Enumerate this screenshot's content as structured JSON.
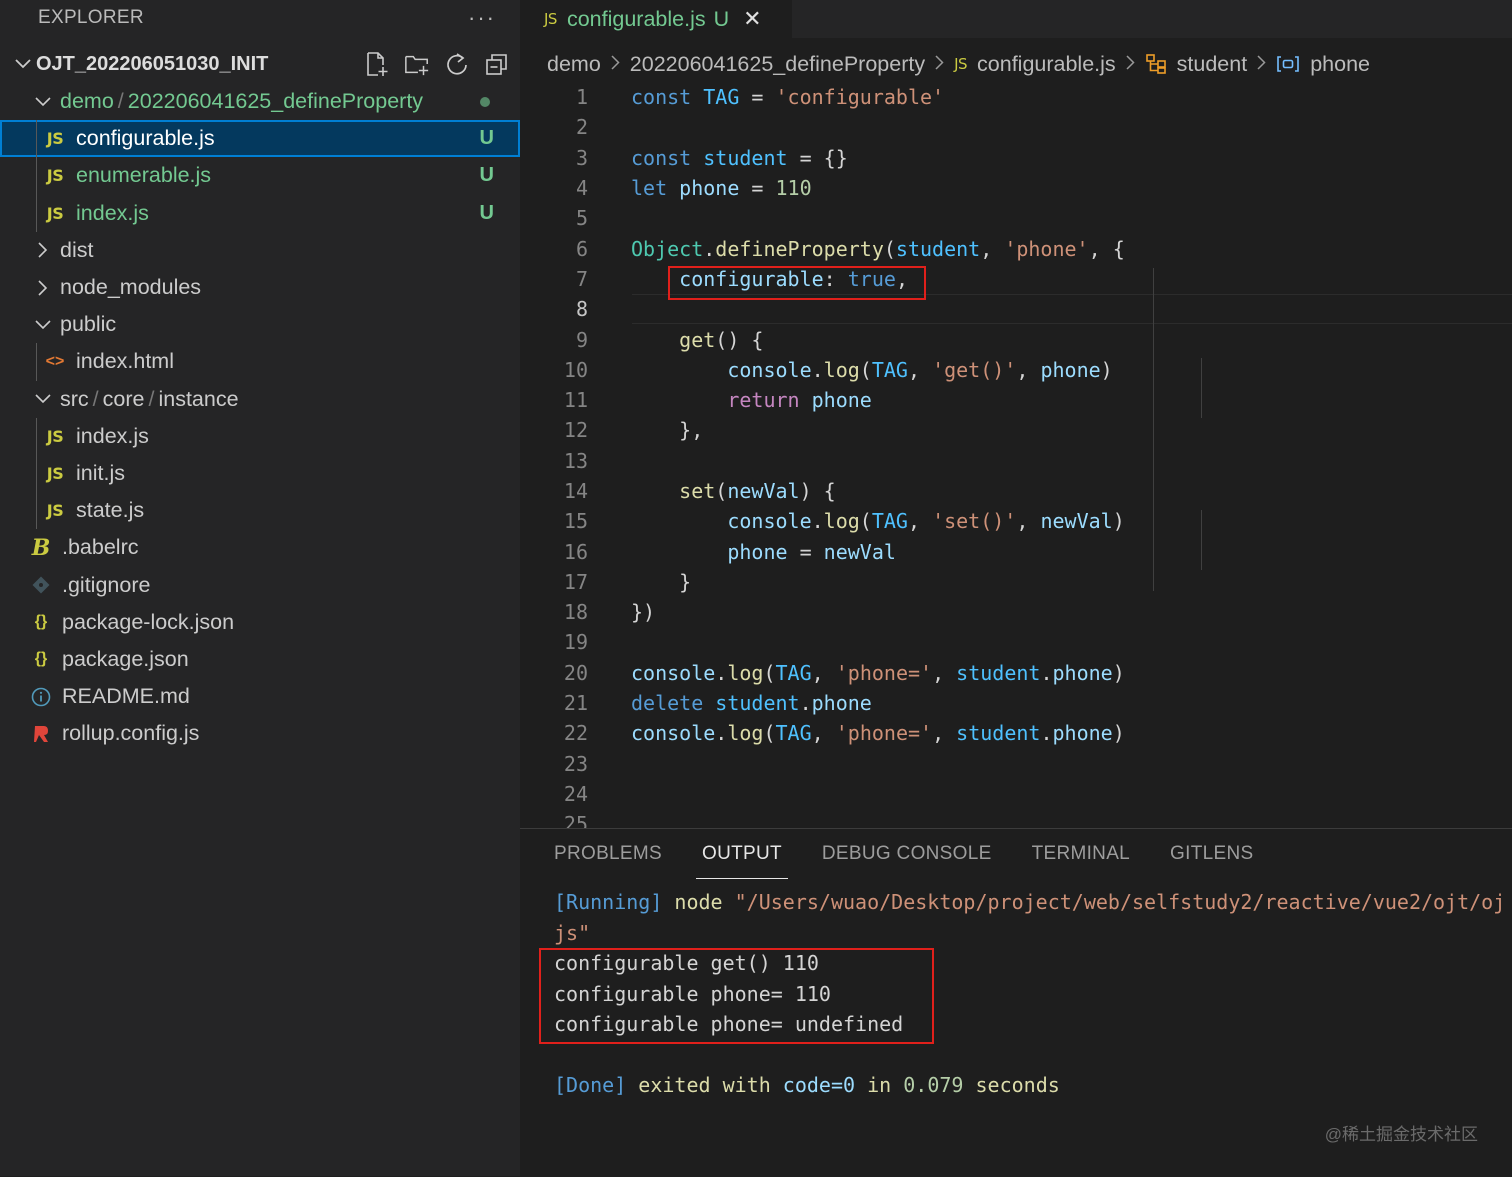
{
  "explorer": {
    "title": "EXPLORER",
    "more": "···",
    "project": "OJT_202206051030_INIT",
    "actions": [
      "new-file-icon",
      "new-folder-icon",
      "refresh-icon",
      "collapse-icon"
    ],
    "items": [
      {
        "kind": "folder",
        "open": true,
        "level": 1,
        "parts": [
          "demo",
          "202206041625_defineProperty"
        ],
        "color": "green",
        "dot": true
      },
      {
        "kind": "js",
        "level": 2,
        "label": "configurable.js",
        "badge": "U",
        "selected": true
      },
      {
        "kind": "js",
        "level": 2,
        "label": "enumerable.js",
        "badge": "U"
      },
      {
        "kind": "js",
        "level": 2,
        "label": "index.js",
        "badge": "U"
      },
      {
        "kind": "folder",
        "open": false,
        "level": 1,
        "parts": [
          "dist"
        ]
      },
      {
        "kind": "folder",
        "open": false,
        "level": 1,
        "parts": [
          "node_modules"
        ]
      },
      {
        "kind": "folder",
        "open": true,
        "level": 1,
        "parts": [
          "public"
        ]
      },
      {
        "kind": "html",
        "level": 2,
        "label": "index.html"
      },
      {
        "kind": "folder",
        "open": true,
        "level": 1,
        "parts": [
          "src",
          "core",
          "instance"
        ]
      },
      {
        "kind": "js",
        "level": 2,
        "label": "index.js"
      },
      {
        "kind": "js",
        "level": 2,
        "label": "init.js"
      },
      {
        "kind": "js",
        "level": 2,
        "label": "state.js"
      },
      {
        "kind": "babel",
        "level": 1,
        "label": ".babelrc"
      },
      {
        "kind": "git",
        "level": 1,
        "label": ".gitignore"
      },
      {
        "kind": "json",
        "level": 1,
        "label": "package-lock.json"
      },
      {
        "kind": "json",
        "level": 1,
        "label": "package.json"
      },
      {
        "kind": "info",
        "level": 1,
        "label": "README.md"
      },
      {
        "kind": "rollup",
        "level": 1,
        "label": "rollup.config.js"
      }
    ]
  },
  "tab": {
    "icon": "JS",
    "label": "configurable.js",
    "status": "U",
    "close": "✕"
  },
  "breadcrumb": [
    "demo",
    "202206041625_defineProperty",
    "configurable.js",
    "student",
    "phone"
  ],
  "code": {
    "active_line": 8,
    "lines": [
      [
        [
          "kw",
          "const"
        ],
        [
          "pun",
          " "
        ],
        [
          "cst",
          "TAG"
        ],
        [
          "pun",
          " = "
        ],
        [
          "str",
          "'configurable'"
        ]
      ],
      [],
      [
        [
          "kw",
          "const"
        ],
        [
          "pun",
          " "
        ],
        [
          "cst",
          "student"
        ],
        [
          "pun",
          " = {}"
        ]
      ],
      [
        [
          "kw",
          "let"
        ],
        [
          "pun",
          " "
        ],
        [
          "var",
          "phone"
        ],
        [
          "pun",
          " = "
        ],
        [
          "num",
          "110"
        ]
      ],
      [],
      [
        [
          "cls",
          "Object"
        ],
        [
          "pun",
          "."
        ],
        [
          "fn",
          "defineProperty"
        ],
        [
          "pun",
          "("
        ],
        [
          "cst",
          "student"
        ],
        [
          "pun",
          ", "
        ],
        [
          "str",
          "'phone'"
        ],
        [
          "pun",
          ", {"
        ]
      ],
      [
        [
          "pun",
          "    "
        ],
        [
          "var",
          "configurable"
        ],
        [
          "pun",
          ": "
        ],
        [
          "kw",
          "true"
        ],
        [
          "pun",
          ","
        ]
      ],
      [],
      [
        [
          "pun",
          "    "
        ],
        [
          "fn",
          "get"
        ],
        [
          "pun",
          "() {"
        ]
      ],
      [
        [
          "pun",
          "        "
        ],
        [
          "var",
          "console"
        ],
        [
          "pun",
          "."
        ],
        [
          "fn",
          "log"
        ],
        [
          "pun",
          "("
        ],
        [
          "cst",
          "TAG"
        ],
        [
          "pun",
          ", "
        ],
        [
          "str",
          "'get()'"
        ],
        [
          "pun",
          ", "
        ],
        [
          "var",
          "phone"
        ],
        [
          "pun",
          ")"
        ]
      ],
      [
        [
          "pun",
          "        "
        ],
        [
          "ctl",
          "return"
        ],
        [
          "pun",
          " "
        ],
        [
          "var",
          "phone"
        ]
      ],
      [
        [
          "pun",
          "    },"
        ]
      ],
      [],
      [
        [
          "pun",
          "    "
        ],
        [
          "fn",
          "set"
        ],
        [
          "pun",
          "("
        ],
        [
          "var",
          "newVal"
        ],
        [
          "pun",
          ") {"
        ]
      ],
      [
        [
          "pun",
          "        "
        ],
        [
          "var",
          "console"
        ],
        [
          "pun",
          "."
        ],
        [
          "fn",
          "log"
        ],
        [
          "pun",
          "("
        ],
        [
          "cst",
          "TAG"
        ],
        [
          "pun",
          ", "
        ],
        [
          "str",
          "'set()'"
        ],
        [
          "pun",
          ", "
        ],
        [
          "var",
          "newVal"
        ],
        [
          "pun",
          ")"
        ]
      ],
      [
        [
          "pun",
          "        "
        ],
        [
          "var",
          "phone"
        ],
        [
          "pun",
          " = "
        ],
        [
          "var",
          "newVal"
        ]
      ],
      [
        [
          "pun",
          "    }"
        ]
      ],
      [
        [
          "pun",
          "})"
        ]
      ],
      [],
      [
        [
          "var",
          "console"
        ],
        [
          "pun",
          "."
        ],
        [
          "fn",
          "log"
        ],
        [
          "pun",
          "("
        ],
        [
          "cst",
          "TAG"
        ],
        [
          "pun",
          ", "
        ],
        [
          "str",
          "'phone='"
        ],
        [
          "pun",
          ", "
        ],
        [
          "cst",
          "student"
        ],
        [
          "pun",
          "."
        ],
        [
          "var",
          "phone"
        ],
        [
          "pun",
          ")"
        ]
      ],
      [
        [
          "kw",
          "delete"
        ],
        [
          "pun",
          " "
        ],
        [
          "cst",
          "student"
        ],
        [
          "pun",
          "."
        ],
        [
          "var",
          "phone"
        ]
      ],
      [
        [
          "var",
          "console"
        ],
        [
          "pun",
          "."
        ],
        [
          "fn",
          "log"
        ],
        [
          "pun",
          "("
        ],
        [
          "cst",
          "TAG"
        ],
        [
          "pun",
          ", "
        ],
        [
          "str",
          "'phone='"
        ],
        [
          "pun",
          ", "
        ],
        [
          "cst",
          "student"
        ],
        [
          "pun",
          "."
        ],
        [
          "var",
          "phone"
        ],
        [
          "pun",
          ")"
        ]
      ],
      [],
      [],
      []
    ]
  },
  "panel": {
    "tabs": [
      "PROBLEMS",
      "OUTPUT",
      "DEBUG CONSOLE",
      "TERMINAL",
      "GITLENS"
    ],
    "active_tab": "OUTPUT",
    "output": {
      "running_tag": "[Running]",
      "running_cmd": "node",
      "running_path": "\"/Users/wuao/Desktop/project/web/selfstudy2/reactive/vue2/ojt/oj",
      "running_path_cont": "js\"",
      "results": [
        "configurable get() 110",
        "configurable phone= 110",
        "configurable phone= undefined"
      ],
      "done_tag": "[Done]",
      "done_text1": "exited with",
      "done_code": "code=0",
      "done_text2": "in",
      "done_time": "0.079",
      "done_text3": "seconds"
    }
  },
  "watermark": "@稀土掘金技术社区"
}
